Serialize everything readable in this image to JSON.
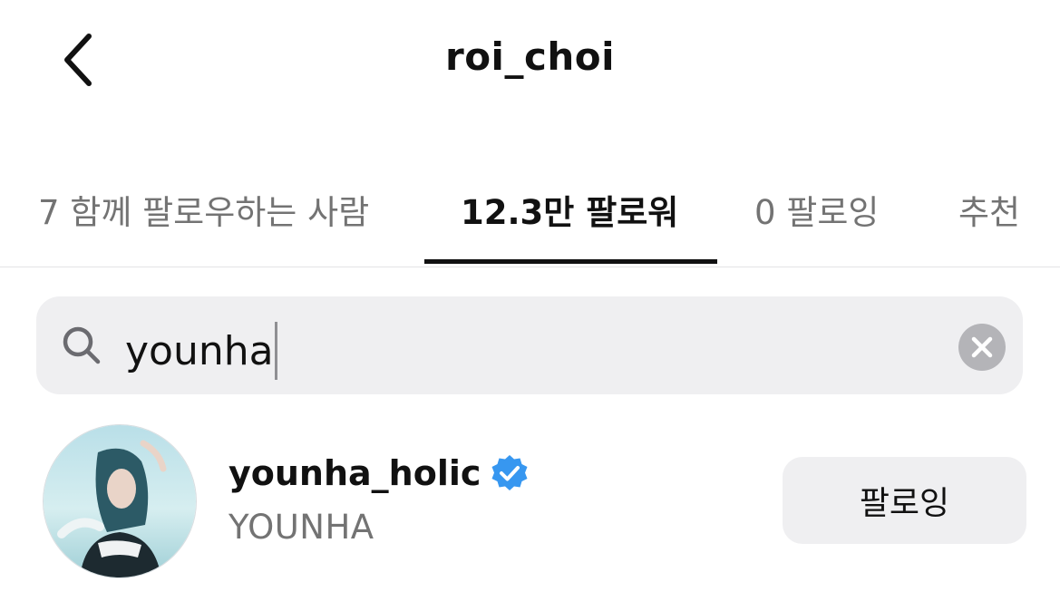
{
  "header": {
    "title": "roi_choi",
    "back_icon": "chevron-left-icon"
  },
  "tabs": [
    {
      "label": "7 함께 팔로우하는 사람",
      "active": false
    },
    {
      "label": "12.3만 팔로워",
      "active": true
    },
    {
      "label": "0 팔로잉",
      "active": false
    },
    {
      "label": "추천",
      "active": false
    }
  ],
  "search": {
    "value": "younha",
    "icon": "search-icon",
    "clear_icon": "clear-x-icon"
  },
  "results": [
    {
      "username": "younha_holic",
      "full_name": "YOUNHA",
      "verified": true,
      "action_label": "팔로잉"
    }
  ],
  "colors": {
    "verified_badge": "#3797f0",
    "secondary_text": "#737373",
    "search_background": "#efeff1",
    "button_background": "#efeff1"
  }
}
